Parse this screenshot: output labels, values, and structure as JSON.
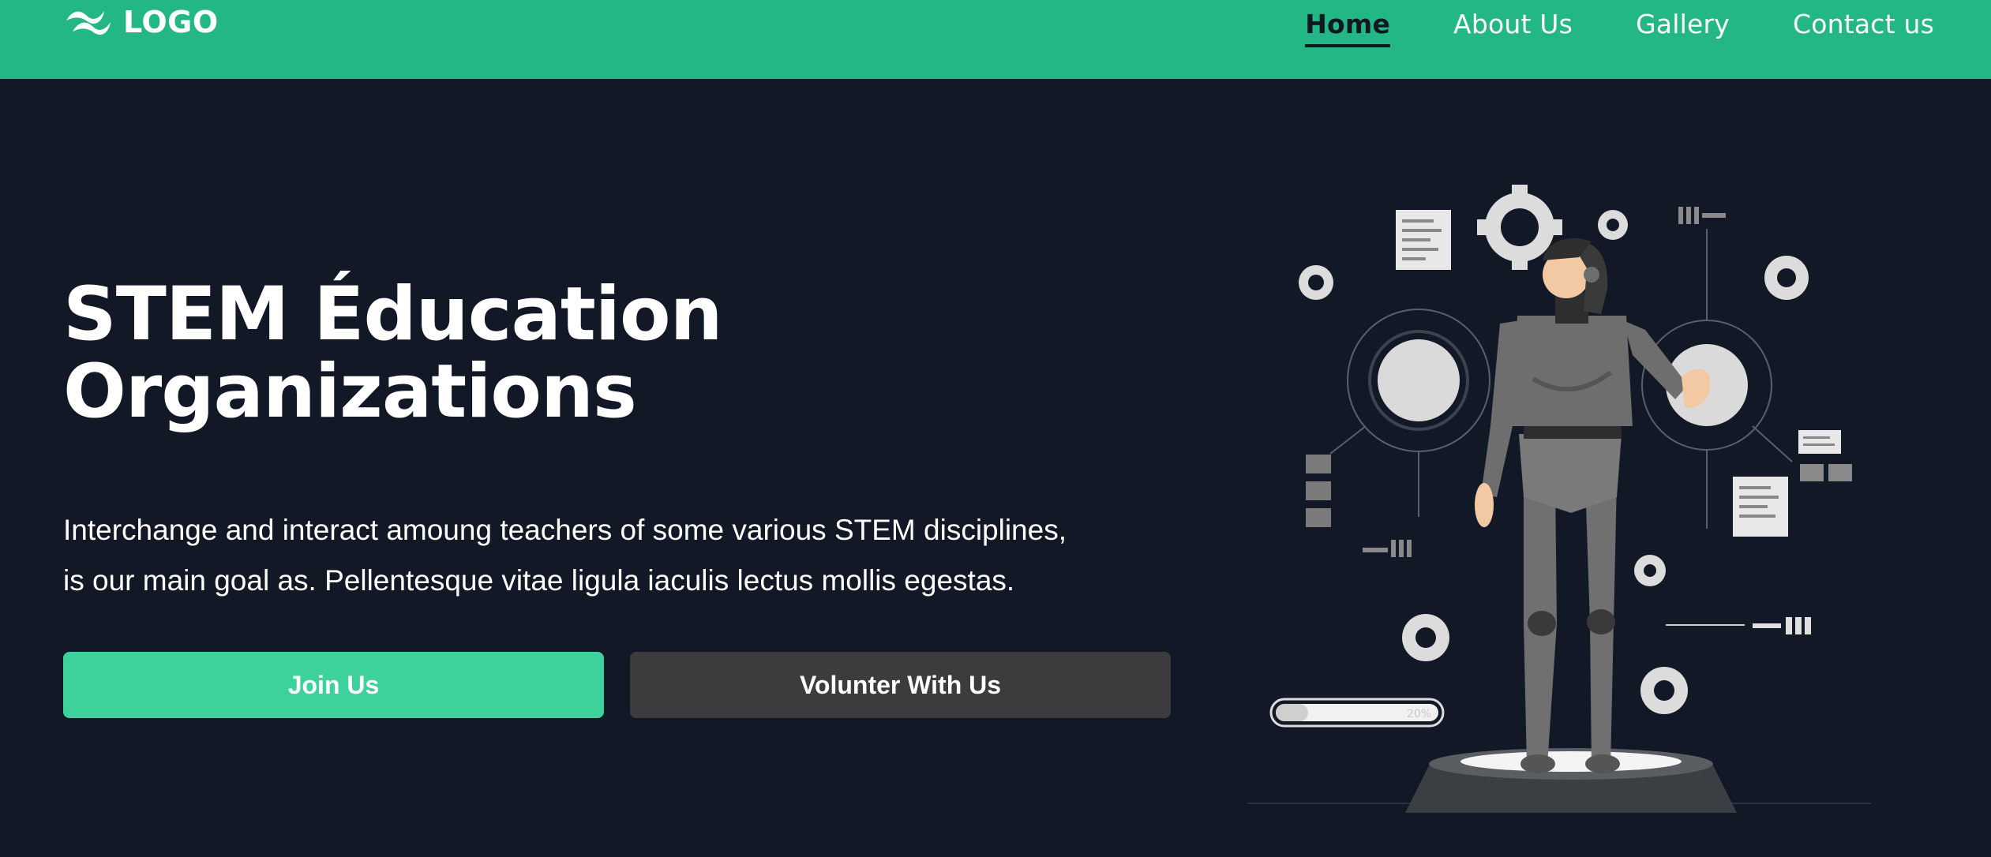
{
  "header": {
    "logo_text": "LOGO",
    "nav": [
      {
        "label": "Home",
        "active": true
      },
      {
        "label": "About Us",
        "active": false
      },
      {
        "label": "Gallery",
        "active": false
      },
      {
        "label": "Contact us",
        "active": false
      }
    ]
  },
  "hero": {
    "title_line1": "STEM Éducation",
    "title_line2": "Organizations",
    "desc_line1": "Interchange and interact amoung teachers of some various STEM disciplines,",
    "desc_line2": "is our main goal as. Pellentesque vitae ligula iaculis lectus mollis egestas.",
    "join_label": "Join Us",
    "volunteer_label": "Volunter With Us"
  },
  "illustration": {
    "progress_text": "20%",
    "progress_value": 0.2
  },
  "colors": {
    "header": "#22b785",
    "background": "#121826",
    "join_button": "#3dd29b",
    "volunteer_button": "#3c3c3e"
  }
}
